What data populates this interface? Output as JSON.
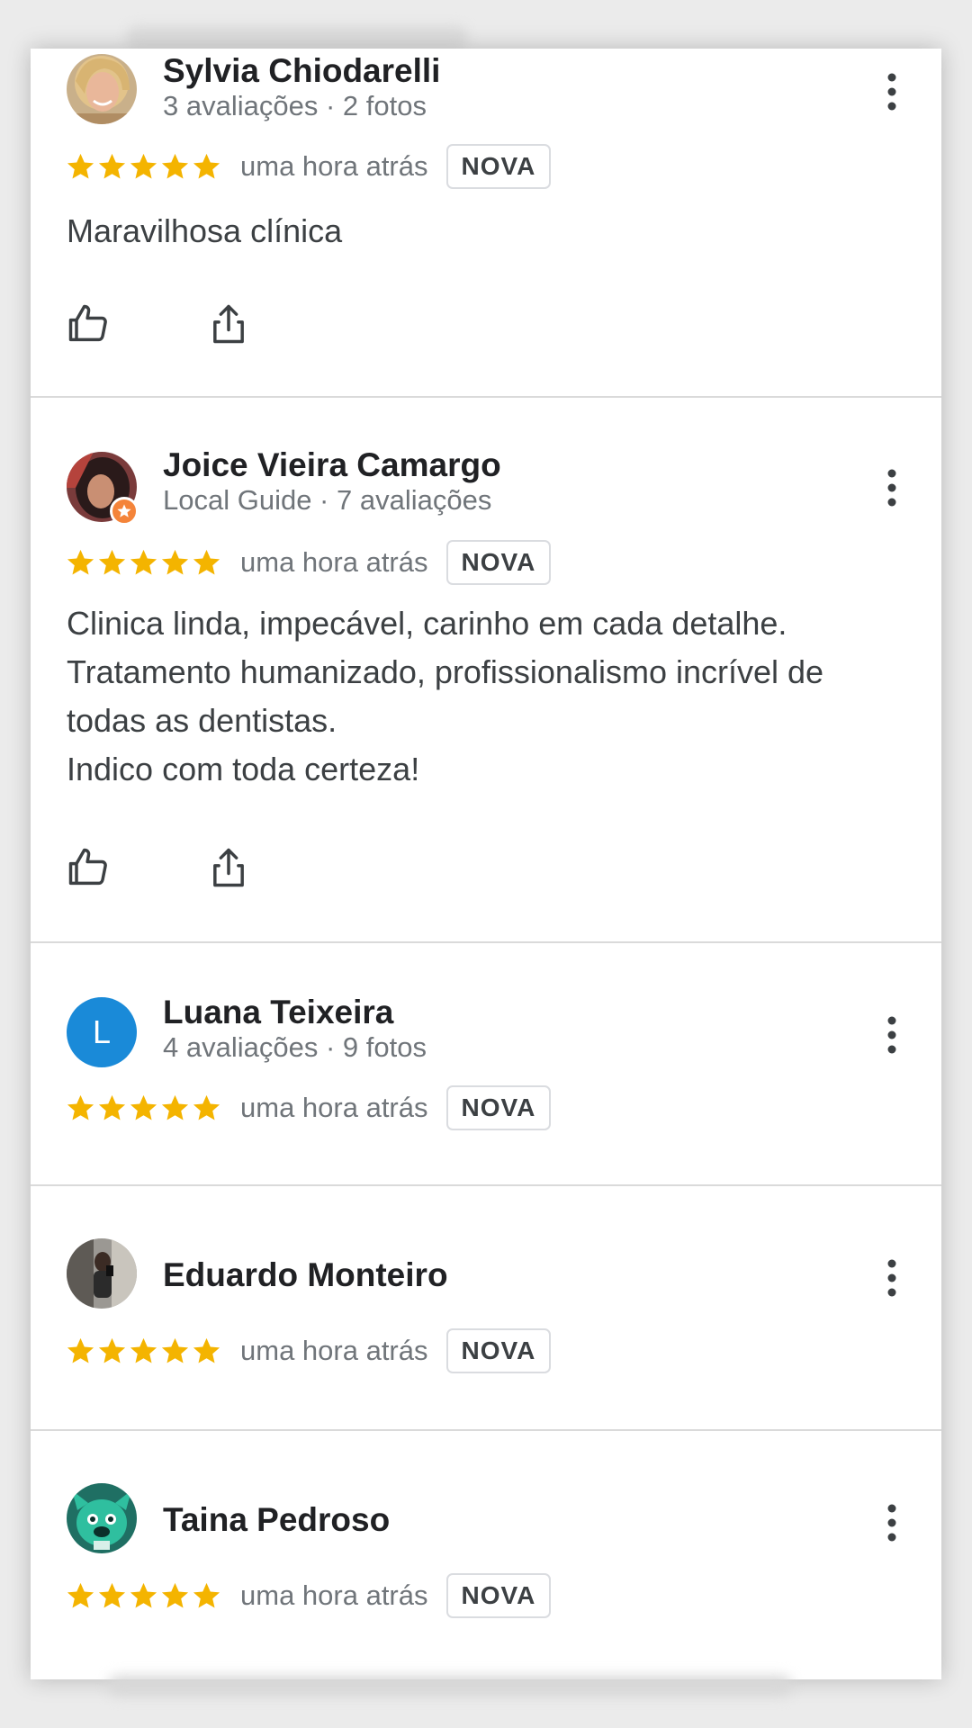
{
  "reviews": [
    {
      "author": "Sylvia Chiodarelli",
      "meta": "3 avaliações · 2 fotos",
      "rating": 5,
      "time": "uma hora atrás",
      "badge": "NOVA",
      "text_lines": [
        "Maravilhosa clínica"
      ],
      "avatar": "photo-woman-blonde",
      "has_actions": true
    },
    {
      "author": "Joice Vieira Camargo",
      "meta": "Local Guide · 7 avaliações",
      "rating": 5,
      "time": "uma hora atrás",
      "badge": "NOVA",
      "text_lines": [
        "Clinica linda, impecável, carinho em cada detalhe.",
        "Tratamento humanizado, profissionalismo incrível de",
        "todas as dentistas.",
        "Indico com toda certeza!"
      ],
      "avatar": "photo-woman-dark-hair",
      "local_guide_badge": "local-guide-star",
      "has_actions": true
    },
    {
      "author": "Luana Teixeira",
      "meta": "4 avaliações · 9 fotos",
      "rating": 5,
      "time": "uma hora atrás",
      "badge": "NOVA",
      "avatar_letter": "L",
      "avatar_color": "#1a8ad8",
      "has_actions": false
    },
    {
      "author": "Eduardo Monteiro",
      "rating": 5,
      "time": "uma hora atrás",
      "badge": "NOVA",
      "avatar": "photo-mirror-selfie",
      "has_actions": false
    },
    {
      "author": "Taina Pedroso",
      "rating": 5,
      "time": "uma hora atrás",
      "badge": "NOVA",
      "avatar": "illustration-green-bulldog",
      "has_actions": false
    }
  ],
  "icons": {
    "star": "star-icon",
    "more": "more-vert-icon",
    "like": "thumb-up-icon",
    "share": "share-icon"
  },
  "colors": {
    "star": "#f4b400",
    "text": "#3c4043",
    "secondary_text": "#70757a",
    "divider": "#dadada",
    "badge_border": "#dadce0"
  }
}
